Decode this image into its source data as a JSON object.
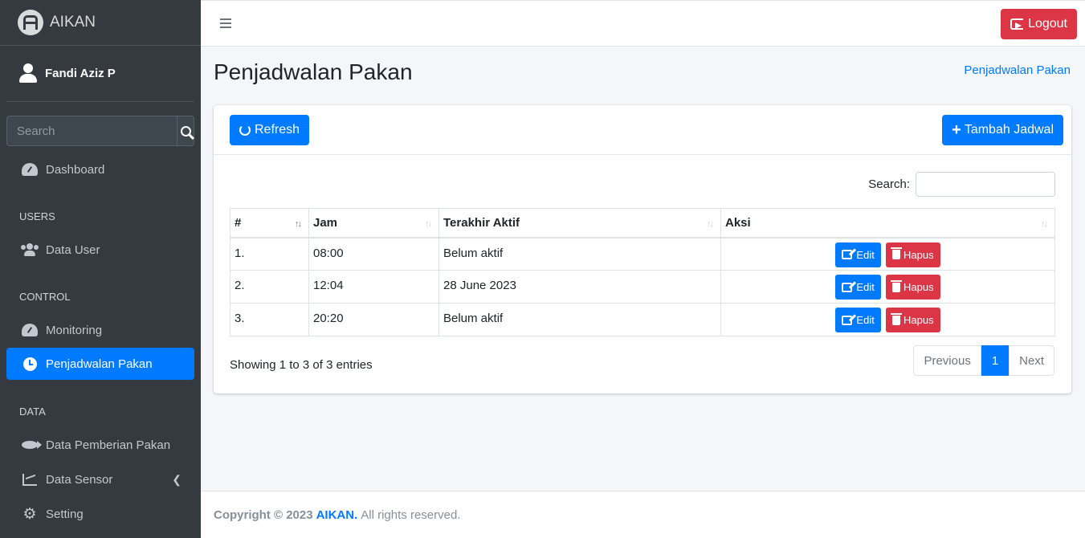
{
  "brand": {
    "name": "AIKAN"
  },
  "user": {
    "name": "Fandi Aziz P"
  },
  "sidebar": {
    "search_placeholder": "Search",
    "items": [
      {
        "label": "Dashboard",
        "icon": "dashboard-icon"
      },
      {
        "header": "USERS"
      },
      {
        "label": "Data User",
        "icon": "users-icon"
      },
      {
        "header": "CONTROL"
      },
      {
        "label": "Monitoring",
        "icon": "gauge-icon"
      },
      {
        "label": "Penjadwalan Pakan",
        "icon": "clock-icon",
        "active": true
      },
      {
        "header": "DATA"
      },
      {
        "label": "Data Pemberian Pakan",
        "icon": "fish-icon"
      },
      {
        "label": "Data Sensor",
        "icon": "chart-icon"
      },
      {
        "label": "Setting",
        "icon": "gears-icon"
      }
    ]
  },
  "topbar": {
    "logout_label": "Logout"
  },
  "page": {
    "title": "Penjadwalan Pakan",
    "breadcrumb": "Penjadwalan Pakan"
  },
  "card": {
    "refresh_label": "Refresh",
    "add_label": "Tambah Jadwal",
    "search_label": "Search:",
    "columns": [
      "#",
      "Jam",
      "Terakhir Aktif",
      "Aksi"
    ],
    "rows": [
      {
        "no": "1.",
        "jam": "08:00",
        "terakhir": "Belum aktif"
      },
      {
        "no": "2.",
        "jam": "12:04",
        "terakhir": "28 June 2023"
      },
      {
        "no": "3.",
        "jam": "20:20",
        "terakhir": "Belum aktif"
      }
    ],
    "edit_label": "Edit",
    "delete_label": "Hapus",
    "info": "Showing 1 to 3 of 3 entries",
    "pagination": {
      "previous": "Previous",
      "current": "1",
      "next": "Next"
    }
  },
  "footer": {
    "copyright": "Copyright © 2023",
    "brand": "AIKAN.",
    "rights": "All rights reserved."
  },
  "colors": {
    "primary": "#007bff",
    "danger": "#dc3545",
    "sidebar": "#343a40"
  }
}
